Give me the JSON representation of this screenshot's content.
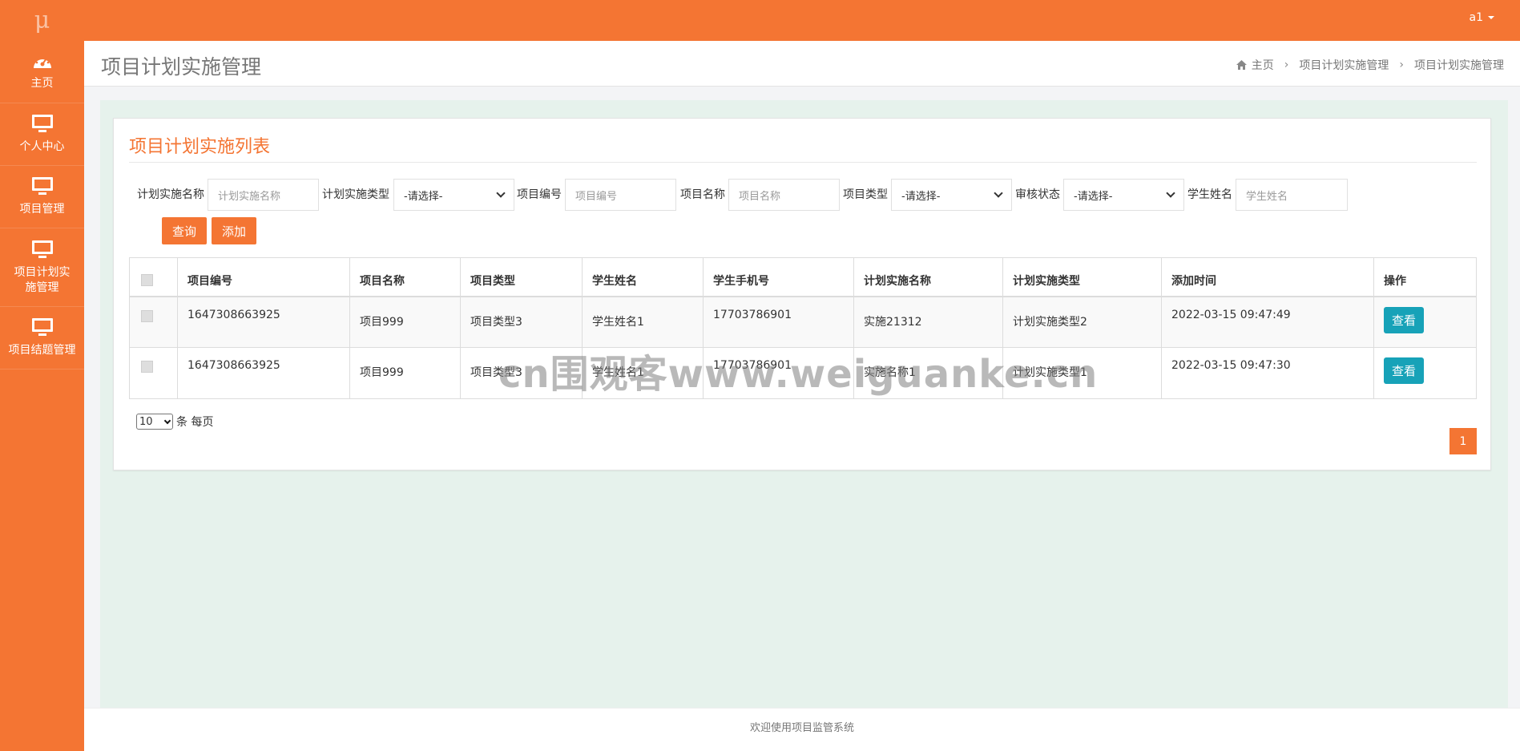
{
  "topbar": {
    "logo": "μ",
    "user": "a1"
  },
  "sidebar": {
    "items": [
      {
        "label": "主页",
        "icon": "dashboard-icon"
      },
      {
        "label": "个人中心",
        "icon": "monitor-icon"
      },
      {
        "label": "项目管理",
        "icon": "monitor-icon"
      },
      {
        "label": "项目计划实施管理",
        "icon": "monitor-icon"
      },
      {
        "label": "项目结题管理",
        "icon": "monitor-icon"
      }
    ]
  },
  "header": {
    "title": "项目计划实施管理",
    "breadcrumb": [
      "主页",
      "项目计划实施管理",
      "项目计划实施管理"
    ]
  },
  "panel": {
    "title": "项目计划实施列表",
    "filters": {
      "plan_name_label": "计划实施名称",
      "plan_name_placeholder": "计划实施名称",
      "plan_type_label": "计划实施类型",
      "plan_type_value": "-请选择-",
      "project_no_label": "项目编号",
      "project_no_placeholder": "项目编号",
      "project_name_label": "项目名称",
      "project_name_placeholder": "项目名称",
      "project_type_label": "项目类型",
      "project_type_value": "-请选择-",
      "review_label": "审核状态",
      "review_value": "-请选择-",
      "student_label": "学生姓名",
      "student_placeholder": "学生姓名"
    },
    "buttons": {
      "query": "查询",
      "add": "添加"
    },
    "table": {
      "headers": [
        "项目编号",
        "项目名称",
        "项目类型",
        "学生姓名",
        "学生手机号",
        "计划实施名称",
        "计划实施类型",
        "添加时间",
        "操作"
      ],
      "rows": [
        {
          "no": "1647308663925",
          "name": "项目999",
          "type": "项目类型3",
          "student": "学生姓名1",
          "phone": "17703786901",
          "plan": "实施21312",
          "plan_type": "计划实施类型2",
          "time": "2022-03-15 09:47:49",
          "action": "查看"
        },
        {
          "no": "1647308663925",
          "name": "项目999",
          "type": "项目类型3",
          "student": "学生姓名1",
          "phone": "17703786901",
          "plan": "实施名称1",
          "plan_type": "计划实施类型1",
          "time": "2022-03-15 09:47:30",
          "action": "查看"
        }
      ]
    },
    "pagination": {
      "page_size": "10",
      "per_page_text": "条 每页",
      "current_page": "1"
    }
  },
  "watermark": "cn围观客www.weiguanke.cn",
  "footer": "欢迎使用项目监管系统",
  "colors": {
    "primary": "#f47533",
    "view_button": "#17a2b8",
    "content_bg": "#e6f2ec"
  }
}
